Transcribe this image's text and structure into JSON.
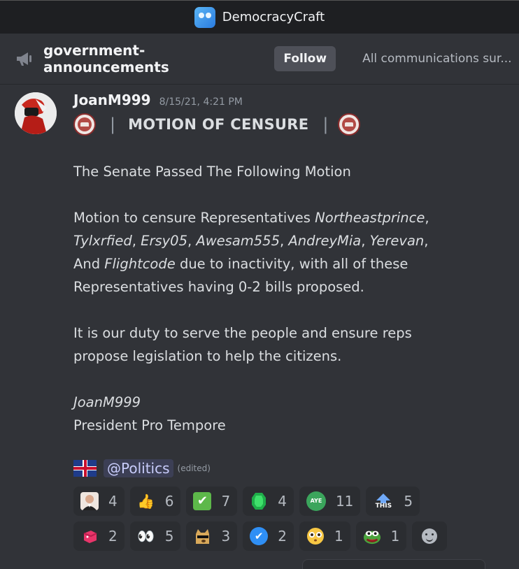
{
  "window": {
    "title": "DemocracyCraft"
  },
  "channel": {
    "name": "government-announcements",
    "follow_label": "Follow",
    "topic": "All communications sur..."
  },
  "message": {
    "author": "JoanM999",
    "timestamp": "8/15/21, 4:21 PM",
    "motion_title": "MOTION OF CENSURE",
    "bar": "|",
    "line1": "The Senate Passed The Following Motion",
    "p2": {
      "t1": "Motion to censure Representatives ",
      "n1": "Northeastprince",
      "c1": ",",
      "n2": "Tylxrfied",
      "c2": ", ",
      "n3": "Ersy05",
      "c3": ", ",
      "n4": "Awesam555",
      "c4": ", ",
      "n5": "AndreyMia",
      "c5": ", ",
      "n6": "Yerevan",
      "c6": ",",
      "t2": "And ",
      "n7": "Flightcode",
      "t3": " due to inactivity, with all of these",
      "t4": "Representatives having 0-2 bills proposed."
    },
    "p3a": "It is our duty to serve the people and ensure reps",
    "p3b": "propose legislation to help the citizens.",
    "sign_name": "JoanM999",
    "sign_title": "President Pro Tempore",
    "role_mention": "@Politics",
    "edited": "(edited)"
  },
  "reactions": {
    "row1": [
      {
        "icon": "portrait-emoji-icon",
        "count": "4"
      },
      {
        "icon": "thumbs-up-icon",
        "glyph": "👍",
        "count": "6"
      },
      {
        "icon": "check-box-icon",
        "glyph": "✔",
        "count": "7"
      },
      {
        "icon": "emerald-icon",
        "count": "4"
      },
      {
        "icon": "aye-icon",
        "label": "AYE",
        "count": "11"
      },
      {
        "icon": "this-arrow-icon",
        "label": "THIS",
        "count": "5"
      }
    ],
    "row2": [
      {
        "icon": "pink-cube-icon",
        "count": "2"
      },
      {
        "icon": "eyes-icon",
        "glyph": "👀",
        "count": "5"
      },
      {
        "icon": "doge-sunglasses-icon",
        "count": "3"
      },
      {
        "icon": "verified-check-icon",
        "glyph": "✔",
        "count": "2"
      },
      {
        "icon": "flushed-face-icon",
        "count": "1"
      },
      {
        "icon": "pepe-frog-icon",
        "count": "1"
      }
    ]
  },
  "colors": {
    "background": "#313338",
    "titlebar": "#1e1f22",
    "mention_bg": "#3c3f55",
    "mention_text": "#c9cdfb"
  }
}
